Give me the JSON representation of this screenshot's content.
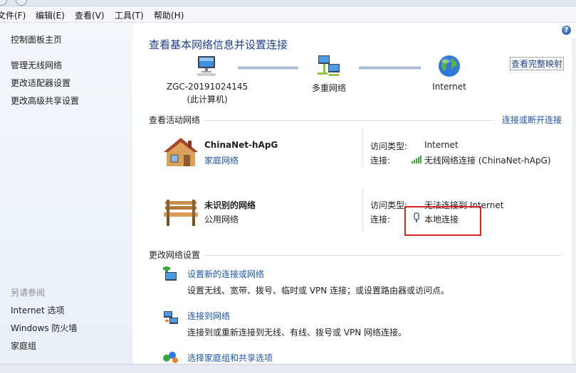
{
  "menu": {
    "items": [
      "文件(F)",
      "编辑(E)",
      "查看(V)",
      "工具(T)",
      "帮助(H)"
    ]
  },
  "sidebar": {
    "items": [
      "控制面板主页",
      "管理无线网络",
      "更改适配器设置",
      "更改高级共享设置"
    ],
    "see_also_title": "另请参阅",
    "see_also": [
      "Internet 选项",
      "Windows 防火墙",
      "家庭组"
    ]
  },
  "main": {
    "title": "查看基本网络信息并设置连接",
    "view_full_map": "查看完整映射",
    "map": {
      "computer_name": "ZGC-20191024145",
      "computer_sub": "(此计算机)",
      "network": "多重网络",
      "internet": "Internet"
    },
    "active_networks_title": "查看活动网络",
    "connect_disconnect": "连接或断开连接",
    "networks": [
      {
        "name": "ChinaNet-hApG",
        "type": "家庭网络",
        "access_label": "访问类型:",
        "access_value": "Internet",
        "conn_label": "连接:",
        "conn_value": "无线网络连接 (ChinaNet-hApG)"
      },
      {
        "name": "未识别的网络",
        "type": "公用网络",
        "access_label": "访问类型:",
        "access_value": "无法连接到 Internet",
        "conn_label": "连接:",
        "conn_value": "本地连接"
      }
    ],
    "change_settings_title": "更改网络设置",
    "tasks": [
      {
        "link": "设置新的连接或网络",
        "desc": "设置无线、宽带、拨号、临时或 VPN 连接；或设置路由器或访问点。"
      },
      {
        "link": "连接到网络",
        "desc": "连接到或重新连接到无线、有线、拨号或 VPN 网络连接。"
      },
      {
        "link": "选择家庭组和共享选项",
        "desc": ""
      }
    ],
    "help_glyph": "?"
  },
  "colors": {
    "link": "#1c55b2",
    "title": "#1e3f8a",
    "highlight": "#d7262a",
    "sidebar_bg": "#eef4fa"
  }
}
